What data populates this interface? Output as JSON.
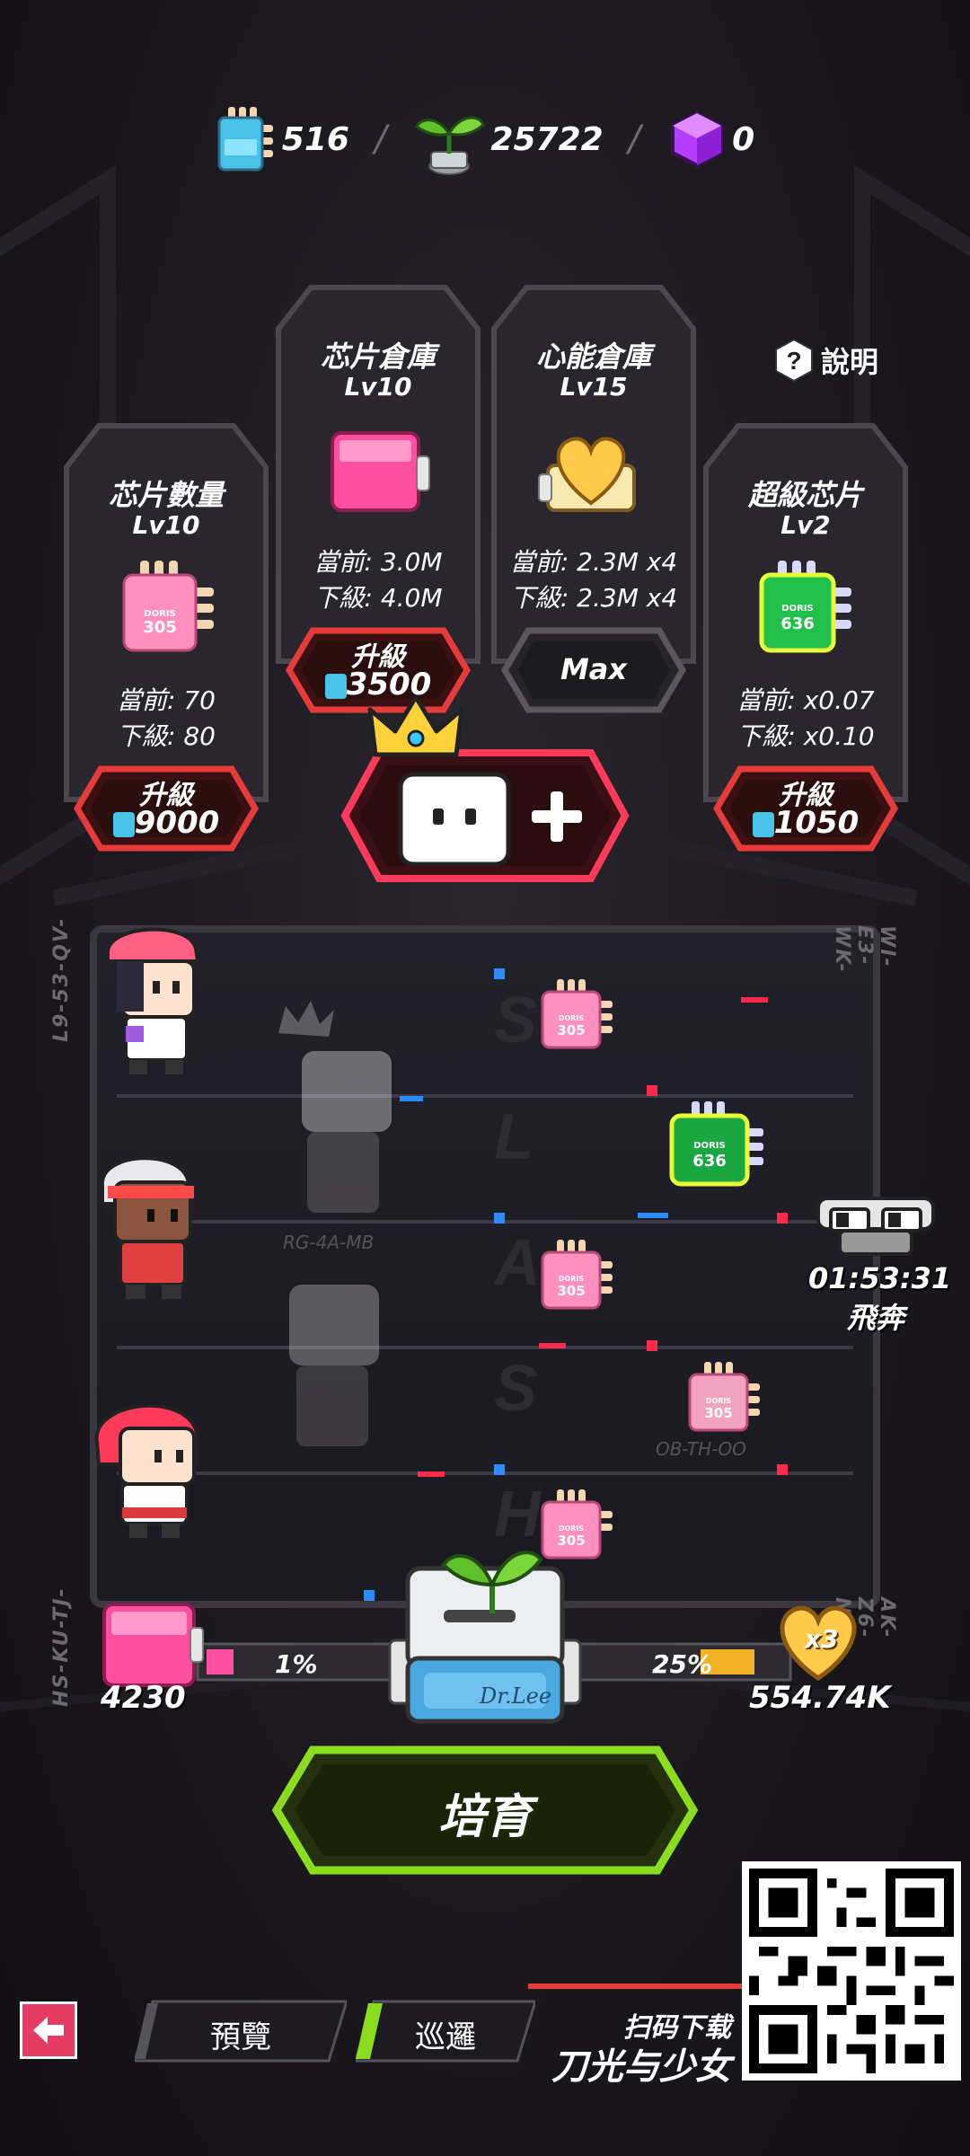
{
  "currency": {
    "chips": "516",
    "sprouts": "25722",
    "cubes": "0"
  },
  "help_label": "說明",
  "cards": [
    {
      "title": "芯片數量",
      "level": "Lv10",
      "current": "當前: 70",
      "next": "下級: 80",
      "button_label": "升級",
      "cost": "9000",
      "chip_code": "305"
    },
    {
      "title": "芯片倉庫",
      "level": "Lv10",
      "current": "當前: 3.0M",
      "next": "下級: 4.0M",
      "button_label": "升級",
      "cost": "3500"
    },
    {
      "title": "心能倉庫",
      "level": "Lv15",
      "current": "當前: 2.3M x4",
      "next": "下級: 2.3M x4",
      "button_label": "Max"
    },
    {
      "title": "超級芯片",
      "level": "Lv2",
      "current": "當前: x0.07",
      "next": "下級: x0.10",
      "button_label": "升級",
      "cost": "1050",
      "chip_code": "636"
    }
  ],
  "board": {
    "codes": [
      "L9-53-QV-",
      "WI-E3-WK-",
      "HS-KU-TJ-",
      "AK-Z6-NB-",
      "RG-4A-MB",
      "OB-TH-OO"
    ],
    "chip_labels": [
      "305",
      "636",
      "305",
      "305",
      "305"
    ],
    "chip_brand": "DORIS",
    "watermark_letters": [
      "S",
      "L",
      "A",
      "S",
      "H"
    ],
    "timer": "01:53:31",
    "timer_label": "飛奔",
    "left_value": "4230",
    "left_pct": "1%",
    "right_pct": "25%",
    "right_value": "554.74K",
    "multiplier": "x3",
    "machine_label": "Dr.Lee"
  },
  "cultivate_label": "培育",
  "nav": {
    "tab1": "預覽",
    "tab2": "巡邏"
  },
  "promo": {
    "top": "扫码下载",
    "main": "刀光与少女"
  },
  "colors": {
    "accent_red": "#e63b3b",
    "accent_green": "#8bdc1e",
    "pink": "#ff5fa5",
    "bg": "#1a171d"
  }
}
